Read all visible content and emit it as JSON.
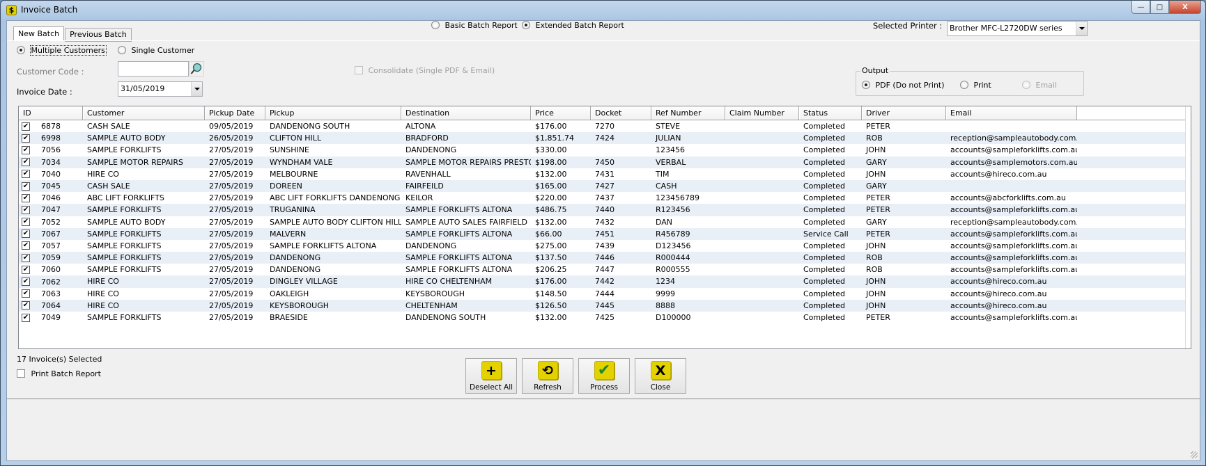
{
  "window": {
    "title": "Invoice Batch",
    "app_icon_glyph": "$",
    "controls": {
      "minimize": "—",
      "maximize": "□",
      "close": "X"
    }
  },
  "tabs": [
    {
      "label": "New Batch",
      "active": true
    },
    {
      "label": "Previous Batch",
      "active": false
    }
  ],
  "customer_mode": {
    "options": [
      {
        "label": "Multiple Customers",
        "checked": true
      },
      {
        "label": "Single Customer",
        "checked": false
      }
    ]
  },
  "report_type": {
    "options": [
      {
        "label": "Basic Batch Report",
        "checked": false
      },
      {
        "label": "Extended Batch Report",
        "checked": true
      }
    ]
  },
  "printer": {
    "label": "Selected Printer :",
    "value": "Brother MFC-L2720DW series"
  },
  "customer_code": {
    "label": "Customer Code :",
    "value": "",
    "search_icon": "magnifier-icon"
  },
  "invoice_date": {
    "label": "Invoice Date :",
    "value": "31/05/2019"
  },
  "consolidate": {
    "label": "Consolidate (Single PDF & Email)",
    "checked": false,
    "disabled": true
  },
  "output": {
    "legend": "Output",
    "options": [
      {
        "label": "PDF (Do not Print)",
        "checked": true,
        "disabled": false
      },
      {
        "label": "Print",
        "checked": false,
        "disabled": false
      },
      {
        "label": "Email",
        "checked": false,
        "disabled": true
      }
    ]
  },
  "grid": {
    "columns": [
      "ID",
      "Customer",
      "Pickup Date",
      "Pickup",
      "Destination",
      "Price",
      "Docket",
      "Ref Number",
      "Claim Number",
      "Status",
      "Driver",
      "Email"
    ],
    "rows": [
      {
        "checked": true,
        "id": "6878",
        "customer": "CASH SALE",
        "pickup_date": "09/05/2019",
        "pickup": "DANDENONG SOUTH",
        "destination": "ALTONA",
        "price": "$176.00",
        "docket": "7270",
        "ref": "STEVE",
        "claim": "",
        "status": "Completed",
        "driver": "PETER",
        "email": ""
      },
      {
        "checked": true,
        "id": "6998",
        "customer": "SAMPLE AUTO BODY",
        "pickup_date": "26/05/2019",
        "pickup": "CLIFTON HILL",
        "destination": "BRADFORD",
        "price": "$1,851.74",
        "docket": "7424",
        "ref": "JULIAN",
        "claim": "",
        "status": "Completed",
        "driver": "ROB",
        "email": "reception@sampleautobody.com.au"
      },
      {
        "checked": true,
        "id": "7056",
        "customer": "SAMPLE FORKLIFTS",
        "pickup_date": "27/05/2019",
        "pickup": "SUNSHINE",
        "destination": "DANDENONG",
        "price": "$330.00",
        "docket": "",
        "ref": "123456",
        "claim": "",
        "status": "Completed",
        "driver": "JOHN",
        "email": "accounts@sampleforklifts.com.au"
      },
      {
        "checked": true,
        "id": "7034",
        "customer": "SAMPLE MOTOR REPAIRS",
        "pickup_date": "27/05/2019",
        "pickup": "WYNDHAM VALE",
        "destination": "SAMPLE MOTOR REPAIRS PRESTON",
        "price": "$198.00",
        "docket": "7450",
        "ref": "VERBAL",
        "claim": "",
        "status": "Completed",
        "driver": "GARY",
        "email": "accounts@samplemotors.com.au"
      },
      {
        "checked": true,
        "id": "7040",
        "customer": "HIRE CO",
        "pickup_date": "27/05/2019",
        "pickup": "MELBOURNE",
        "destination": "RAVENHALL",
        "price": "$132.00",
        "docket": "7431",
        "ref": "TIM",
        "claim": "",
        "status": "Completed",
        "driver": "JOHN",
        "email": "accounts@hireco.com.au"
      },
      {
        "checked": true,
        "id": "7045",
        "customer": "CASH SALE",
        "pickup_date": "27/05/2019",
        "pickup": "DOREEN",
        "destination": "FAIRFEILD",
        "price": "$165.00",
        "docket": "7427",
        "ref": "CASH",
        "claim": "",
        "status": "Completed",
        "driver": "GARY",
        "email": ""
      },
      {
        "checked": true,
        "id": "7046",
        "customer": "ABC LIFT FORKLIFTS",
        "pickup_date": "27/05/2019",
        "pickup": "ABC LIFT FORKLIFTS DANDENONG",
        "destination": "KEILOR",
        "price": "$220.00",
        "docket": "7437",
        "ref": "123456789",
        "claim": "",
        "status": "Completed",
        "driver": "PETER",
        "email": "accounts@abcforklifts.com.au"
      },
      {
        "checked": true,
        "id": "7047",
        "customer": "SAMPLE FORKLIFTS",
        "pickup_date": "27/05/2019",
        "pickup": "TRUGANINA",
        "destination": "SAMPLE FORKLIFTS ALTONA",
        "price": "$486.75",
        "docket": "7440",
        "ref": "R123456",
        "claim": "",
        "status": "Completed",
        "driver": "PETER",
        "email": "accounts@sampleforklifts.com.au"
      },
      {
        "checked": true,
        "id": "7052",
        "customer": "SAMPLE AUTO BODY",
        "pickup_date": "27/05/2019",
        "pickup": "SAMPLE AUTO BODY CLIFTON HILL",
        "destination": "SAMPLE AUTO SALES FAIRFIELD",
        "price": "$132.00",
        "docket": "7432",
        "ref": "DAN",
        "claim": "",
        "status": "Completed",
        "driver": "GARY",
        "email": "reception@sampleautobody.com.au"
      },
      {
        "checked": true,
        "id": "7067",
        "customer": "SAMPLE FORKLIFTS",
        "pickup_date": "27/05/2019",
        "pickup": "MALVERN",
        "destination": "SAMPLE FORKLIFTS ALTONA",
        "price": "$66.00",
        "docket": "7451",
        "ref": "R456789",
        "claim": "",
        "status": "Service Call",
        "driver": "PETER",
        "email": "accounts@sampleforklifts.com.au"
      },
      {
        "checked": true,
        "id": "7057",
        "customer": "SAMPLE FORKLIFTS",
        "pickup_date": "27/05/2019",
        "pickup": "SAMPLE FORKLIFTS ALTONA",
        "destination": "DANDENONG",
        "price": "$275.00",
        "docket": "7439",
        "ref": "D123456",
        "claim": "",
        "status": "Completed",
        "driver": "JOHN",
        "email": "accounts@sampleforklifts.com.au"
      },
      {
        "checked": true,
        "id": "7059",
        "customer": "SAMPLE FORKLIFTS",
        "pickup_date": "27/05/2019",
        "pickup": "DANDENONG",
        "destination": "SAMPLE FORKLIFTS ALTONA",
        "price": "$137.50",
        "docket": "7446",
        "ref": "R000444",
        "claim": "",
        "status": "Completed",
        "driver": "ROB",
        "email": "accounts@sampleforklifts.com.au"
      },
      {
        "checked": true,
        "id": "7060",
        "customer": "SAMPLE FORKLIFTS",
        "pickup_date": "27/05/2019",
        "pickup": "DANDENONG",
        "destination": "SAMPLE FORKLIFTS ALTONA",
        "price": "$206.25",
        "docket": "7447",
        "ref": "R000555",
        "claim": "",
        "status": "Completed",
        "driver": "ROB",
        "email": "accounts@sampleforklifts.com.au"
      },
      {
        "checked": true,
        "id": "7062",
        "customer": "HIRE CO",
        "pickup_date": "27/05/2019",
        "pickup": "DINGLEY VILLAGE",
        "destination": "HIRE CO CHELTENHAM",
        "price": "$176.00",
        "docket": "7442",
        "ref": "1234",
        "claim": "",
        "status": "Completed",
        "driver": "JOHN",
        "email": "accounts@hireco.com.au"
      },
      {
        "checked": true,
        "id": "7063",
        "customer": "HIRE CO",
        "pickup_date": "27/05/2019",
        "pickup": "OAKLEIGH",
        "destination": "KEYSBOROUGH",
        "price": "$148.50",
        "docket": "7444",
        "ref": "9999",
        "claim": "",
        "status": "Completed",
        "driver": "JOHN",
        "email": "accounts@hireco.com.au"
      },
      {
        "checked": true,
        "id": "7064",
        "customer": "HIRE CO",
        "pickup_date": "27/05/2019",
        "pickup": "KEYSBOROUGH",
        "destination": "CHELTENHAM",
        "price": "$126.50",
        "docket": "7445",
        "ref": "8888",
        "claim": "",
        "status": "Completed",
        "driver": "JOHN",
        "email": "accounts@hireco.com.au"
      },
      {
        "checked": true,
        "id": "7049",
        "customer": "SAMPLE FORKLIFTS",
        "pickup_date": "27/05/2019",
        "pickup": "BRAESIDE",
        "destination": "DANDENONG SOUTH",
        "price": "$132.00",
        "docket": "7425",
        "ref": "D100000",
        "claim": "",
        "status": "Completed",
        "driver": "PETER",
        "email": "accounts@sampleforklifts.com.au"
      }
    ]
  },
  "footer": {
    "selected_count": "17 Invoice(s) Selected",
    "print_batch_report": {
      "label": "Print Batch Report",
      "checked": false
    }
  },
  "buttons": [
    {
      "name": "deselect-all-button",
      "label": "Deselect All",
      "icon": "plus-icon",
      "glyph": "+",
      "glyph_color": "#000000"
    },
    {
      "name": "refresh-button",
      "label": "Refresh",
      "icon": "undo-arrow-icon",
      "glyph": "⟲",
      "glyph_color": "#000000"
    },
    {
      "name": "process-button",
      "label": "Process",
      "icon": "checkmark-icon",
      "glyph": "✔",
      "glyph_color": "#1a8a2a"
    },
    {
      "name": "close-button",
      "label": "Close",
      "icon": "x-icon",
      "glyph": "X",
      "glyph_color": "#000000"
    }
  ],
  "colors": {
    "button_icon_bg": "#e3d100",
    "row_alt_bg": "#e9eff7",
    "check_green": "#1a8a2a"
  }
}
